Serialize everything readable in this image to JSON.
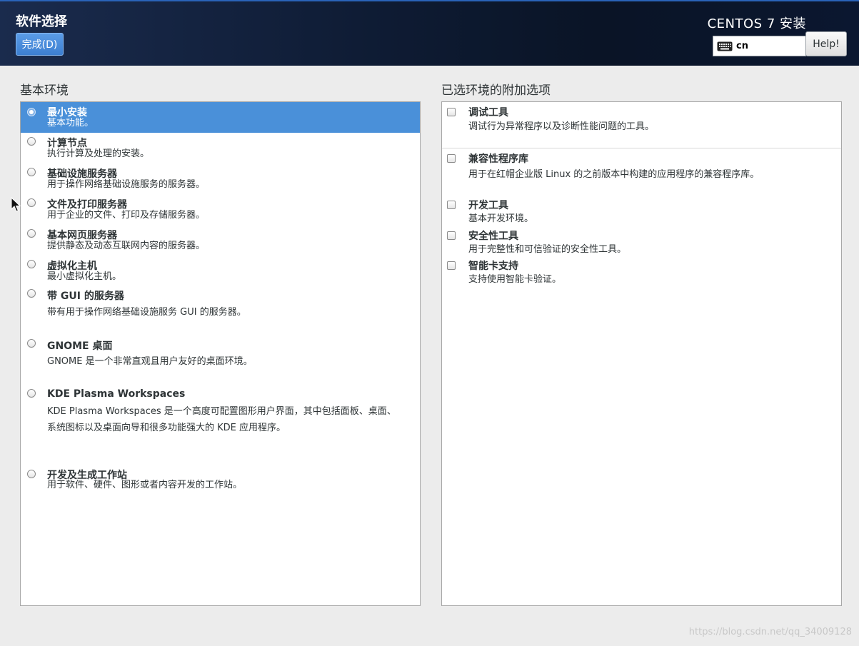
{
  "header": {
    "title": "软件选择",
    "done_label": "完成(D)",
    "product": "CENTOS 7 安装",
    "keyboard_layout": "cn",
    "help_label": "Help!"
  },
  "base_env": {
    "label": "基本环境",
    "items": [
      {
        "name": "最小安装",
        "desc": "基本功能。",
        "selected": true
      },
      {
        "name": "计算节点",
        "desc": "执行计算及处理的安装。"
      },
      {
        "name": "基础设施服务器",
        "desc": "用于操作网络基础设施服务的服务器。"
      },
      {
        "name": "文件及打印服务器",
        "desc": "用于企业的文件、打印及存储服务器。"
      },
      {
        "name": "基本网页服务器",
        "desc": "提供静态及动态互联网内容的服务器。"
      },
      {
        "name": "虚拟化主机",
        "desc": "最小虚拟化主机。"
      },
      {
        "name": "带 GUI 的服务器",
        "desc": "带有用于操作网络基础设施服务 GUI 的服务器。"
      },
      {
        "name": "GNOME 桌面",
        "desc": "GNOME 是一个非常直观且用户友好的桌面环境。"
      },
      {
        "name": "KDE Plasma Workspaces",
        "desc": "KDE Plasma Workspaces 是一个高度可配置图形用户界面，其中包括面板、桌面、系统图标以及桌面向导和很多功能强大的 KDE 应用程序。"
      },
      {
        "name": "开发及生成工作站",
        "desc": "用于软件、硬件、图形或者内容开发的工作站。"
      }
    ]
  },
  "addons": {
    "label": "已选环境的附加选项",
    "items": [
      {
        "name": "调试工具",
        "desc": "调试行为异常程序以及诊断性能问题的工具。"
      },
      {
        "name": "兼容性程序库",
        "desc": "用于在红帽企业版 Linux 的之前版本中构建的应用程序的兼容程序库。"
      },
      {
        "name": "开发工具",
        "desc": "基本开发环境。"
      },
      {
        "name": "安全性工具",
        "desc": "用于完整性和可信验证的安全性工具。"
      },
      {
        "name": "智能卡支持",
        "desc": "支持使用智能卡验证。"
      }
    ]
  },
  "watermark": "https://blog.csdn.net/qq_34009128",
  "colors": {
    "accent": "#4a90d9",
    "header_bg": "#0e1b33"
  }
}
